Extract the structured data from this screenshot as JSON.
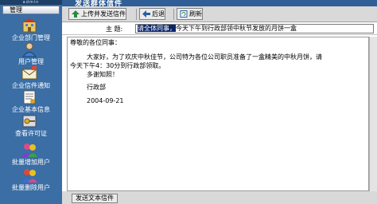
{
  "window": {
    "title": "发送群体信件"
  },
  "sidebar": {
    "header": "admin",
    "manage": "管理",
    "items": [
      {
        "label": "企业部门管理",
        "icon": "building-icon"
      },
      {
        "label": "用户管理",
        "icon": "user-icon"
      },
      {
        "label": "企业信件通知",
        "icon": "envelope-icon"
      },
      {
        "label": "企业基本信息",
        "icon": "info-icon"
      },
      {
        "label": "查看许可证",
        "icon": "key-icon"
      },
      {
        "label": "批量增加用户",
        "icon": "users-add-icon"
      },
      {
        "label": "批量删除用户",
        "icon": "users-delete-icon"
      }
    ]
  },
  "toolbar": {
    "upload_send": "上传并发送信件",
    "back": "后退",
    "refresh": "刷新"
  },
  "subject": {
    "label": "主  题:",
    "selected": "请全体同事，",
    "rest": "今天下午到行政部领中秋节发放的月饼一盒"
  },
  "message": {
    "greeting": "尊敬的各位同事：",
    "line1": "大家好，为了欢庆中秋佳节，公司特为各位公司职员准备了一盒精美的中秋月饼，请",
    "line2": "今天下午4：30分到行政部领取。",
    "thanks": "多谢知照！",
    "signature": "行政部",
    "date": "2004-09-21"
  },
  "bottom": {
    "send_text": "发送文本信件"
  },
  "colors": {
    "sidebar": "#3a6ea5",
    "titlebar": "#2f5f96",
    "toolbar": "#d9d9d9"
  }
}
